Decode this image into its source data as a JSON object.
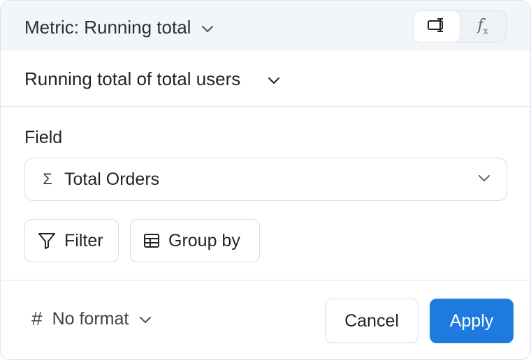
{
  "header": {
    "title": "Metric: Running total",
    "modes": [
      {
        "icon": "editor-mode-icon",
        "active": true
      },
      {
        "icon": "formula-icon",
        "label": "f",
        "sub": "x",
        "active": false
      }
    ]
  },
  "metric": {
    "name": "Running total of total users"
  },
  "field": {
    "label": "Field",
    "icon": "sigma-icon",
    "symbol": "Σ",
    "value": "Total Orders"
  },
  "actions": {
    "filter_label": "Filter",
    "group_by_label": "Group by"
  },
  "footer": {
    "format_symbol": "#",
    "format_label": "No format",
    "cancel_label": "Cancel",
    "apply_label": "Apply"
  },
  "colors": {
    "accent": "#1f7ae0",
    "header_bg": "#f3f6f9",
    "border": "#dfe3e8"
  }
}
